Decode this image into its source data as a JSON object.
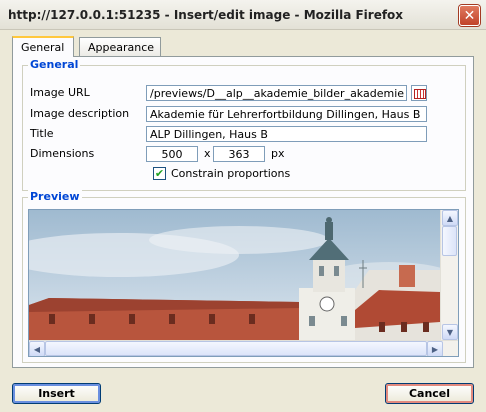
{
  "window": {
    "title": "http://127.0.0.1:51235 - Insert/edit image - Mozilla Firefox"
  },
  "tabs": [
    {
      "label": "General",
      "active": true
    },
    {
      "label": "Appearance",
      "active": false
    }
  ],
  "general": {
    "legend": "General",
    "image_url": {
      "label": "Image URL",
      "value": "/previews/D__alp__akademie_bilder_akademie"
    },
    "image_description": {
      "label": "Image description",
      "value": "Akademie für Lehrerfortbildung Dillingen, Haus B"
    },
    "title": {
      "label": "Title",
      "value": "ALP Dillingen, Haus B"
    },
    "dimensions": {
      "label": "Dimensions",
      "width": "500",
      "separator": "x",
      "height": "363",
      "unit": "px"
    },
    "constrain": {
      "label": "Constrain proportions",
      "checked": true
    }
  },
  "preview": {
    "legend": "Preview"
  },
  "buttons": {
    "insert": "Insert",
    "cancel": "Cancel"
  },
  "colors": {
    "legend": "#0046d5",
    "input_border": "#7f9db9",
    "dialog_bg": "#ece9d8",
    "close": "#c1432a"
  }
}
